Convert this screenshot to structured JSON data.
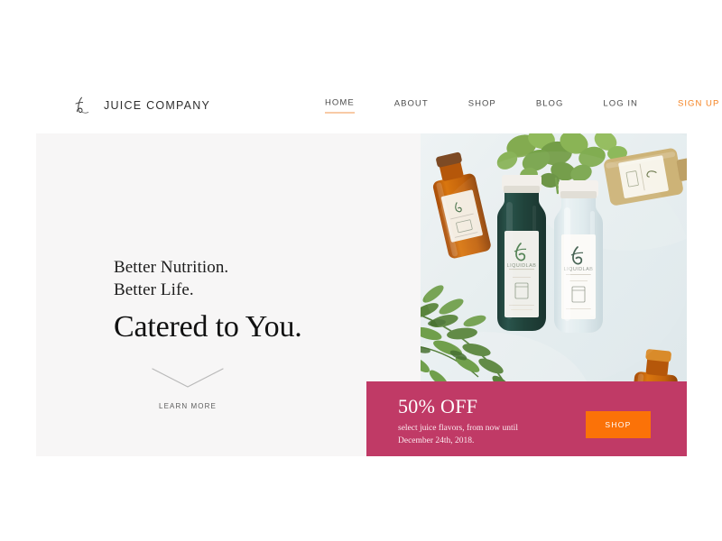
{
  "header": {
    "brand": {
      "logo_icon": "script-l-monogram-icon",
      "name": "JUICE COMPANY"
    },
    "nav": [
      {
        "label": "HOME",
        "active": true,
        "accent": false
      },
      {
        "label": "ABOUT",
        "active": false,
        "accent": false
      },
      {
        "label": "SHOP",
        "active": false,
        "accent": false
      },
      {
        "label": "BLOG",
        "active": false,
        "accent": false
      },
      {
        "label": "LOG IN",
        "active": false,
        "accent": false
      },
      {
        "label": "SIGN UP",
        "active": false,
        "accent": true
      }
    ],
    "cart_icon": "shopping-cart-icon"
  },
  "hero": {
    "eyebrow_line_1": "Better Nutrition.",
    "eyebrow_line_2": "Better Life.",
    "headline": "Catered to You.",
    "learn_more": {
      "icon": "chevron-down-icon",
      "label": "LEARN MORE"
    },
    "photo_alt": "Flat lay of juice bottles with green foliage"
  },
  "promo": {
    "title": "50% OFF",
    "subtitle_line_1": "select juice flavors, from now until",
    "subtitle_line_2": "December 24th, 2018.",
    "button_label": "SHOP"
  },
  "colors": {
    "accent_orange": "#f58220",
    "button_orange": "#fb7208",
    "promo_pink": "#c03a66",
    "hero_background": "#f7f6f6",
    "page_background": "#ffffff",
    "text_dark": "#1d1d1d"
  }
}
